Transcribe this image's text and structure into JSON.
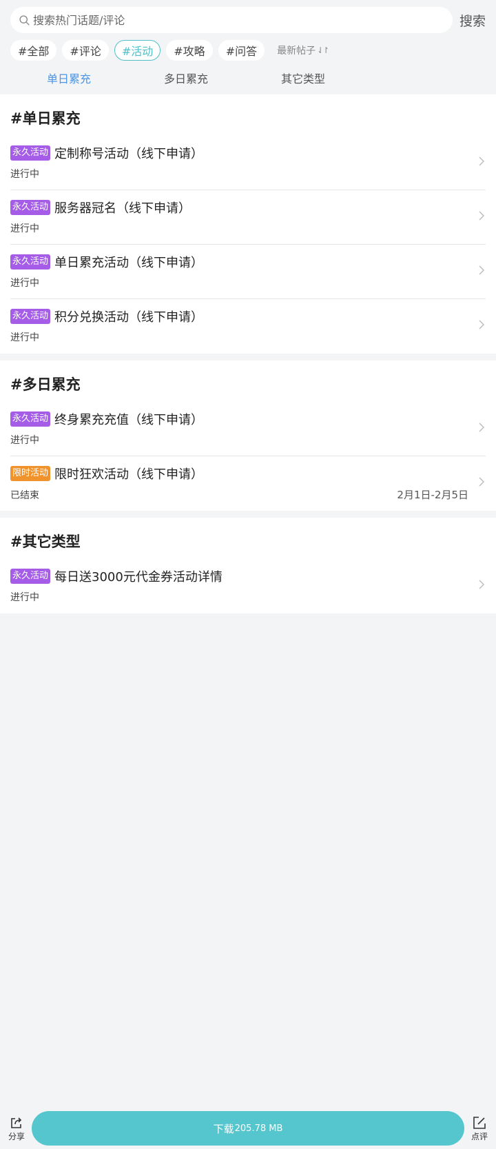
{
  "search": {
    "placeholder": "搜索热门话题/评论",
    "button_label": "搜索"
  },
  "chips": [
    {
      "label": "#全部",
      "active": false
    },
    {
      "label": "#评论",
      "active": false
    },
    {
      "label": "#活动",
      "active": true
    },
    {
      "label": "#攻略",
      "active": false
    },
    {
      "label": "#问答",
      "active": false
    }
  ],
  "sort": {
    "label": "最新帖子",
    "arrow": "⇃↾"
  },
  "tabs": [
    {
      "label": "单日累充",
      "active": true
    },
    {
      "label": "多日累充",
      "active": false
    },
    {
      "label": "其它类型",
      "active": false
    }
  ],
  "sections": [
    {
      "title": "#单日累充",
      "items": [
        {
          "badge": "永久活动",
          "badge_color": "#a55de8",
          "title": "定制称号活动（线下申请）",
          "status": "进行中",
          "date": ""
        },
        {
          "badge": "永久活动",
          "badge_color": "#a55de8",
          "title": "服务器冠名（线下申请）",
          "status": "进行中",
          "date": ""
        },
        {
          "badge": "永久活动",
          "badge_color": "#a55de8",
          "title": "单日累充活动（线下申请）",
          "status": "进行中",
          "date": ""
        },
        {
          "badge": "永久活动",
          "badge_color": "#a55de8",
          "title": "积分兑换活动（线下申请）",
          "status": "进行中",
          "date": ""
        }
      ]
    },
    {
      "title": "#多日累充",
      "items": [
        {
          "badge": "永久活动",
          "badge_color": "#a55de8",
          "title": "终身累充充值（线下申请）",
          "status": "进行中",
          "date": ""
        },
        {
          "badge": "限时活动",
          "badge_color": "#f0932c",
          "title": "限时狂欢活动（线下申请）",
          "status": "已结束",
          "date": "2月1日-2月5日"
        }
      ]
    },
    {
      "title": "#其它类型",
      "items": [
        {
          "badge": "永久活动",
          "badge_color": "#a55de8",
          "title": "每日送3000元代金券活动详情",
          "status": "进行中",
          "date": ""
        }
      ]
    }
  ],
  "bottom": {
    "share_label": "分享",
    "download_label": "下载",
    "download_size": "205.78 MB",
    "review_label": "点评"
  }
}
